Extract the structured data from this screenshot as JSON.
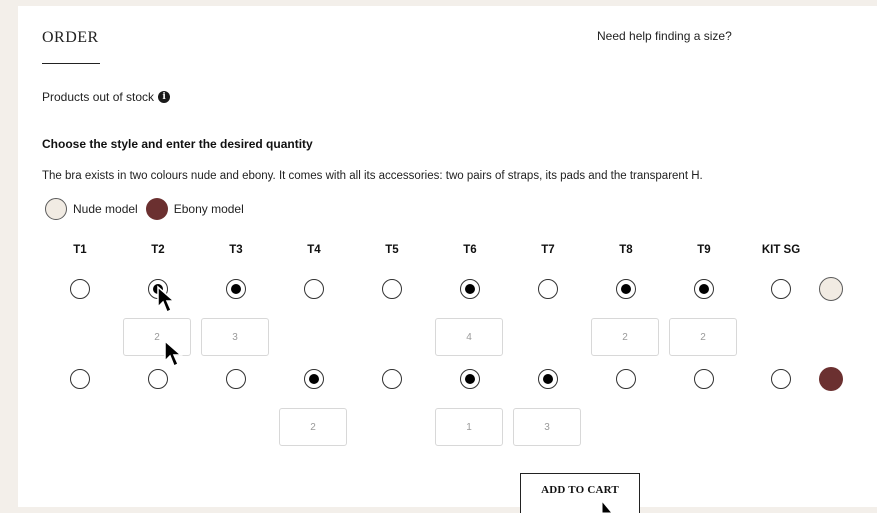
{
  "order": {
    "title": "ORDER",
    "help_link": "Need help finding a size?",
    "out_of_stock": "Products out of stock",
    "heading": "Choose the style and enter the desired quantity",
    "description": "The bra exists in two colours nude and ebony. It comes with all its accessories: two pairs of straps, its pads and the transparent H.",
    "legend": [
      {
        "label": "Nude model",
        "color": "#f1ebe3"
      },
      {
        "label": "Ebony model",
        "color": "#6b3030"
      }
    ],
    "sizes": [
      "T1",
      "T2",
      "T3",
      "T4",
      "T5",
      "T6",
      "T7",
      "T8",
      "T9",
      "KIT SG"
    ],
    "rows": [
      {
        "model": "nude",
        "selected": [
          false,
          true,
          true,
          false,
          false,
          true,
          false,
          true,
          true,
          false
        ],
        "quantities": [
          "",
          "2",
          "3",
          "",
          "",
          "4",
          "",
          "2",
          "2",
          ""
        ]
      },
      {
        "model": "ebony",
        "selected": [
          false,
          false,
          false,
          true,
          false,
          true,
          true,
          false,
          false,
          false
        ],
        "quantities": [
          "",
          "",
          "",
          "2",
          "",
          "1",
          "3",
          "",
          "",
          ""
        ]
      }
    ],
    "add_to_cart": "ADD TO CART"
  },
  "icons": {
    "info": "info-icon",
    "cursor": "mouse-pointer-icon"
  },
  "colors": {
    "page_bg": "#f3efea",
    "nude": "#f1ebe3",
    "ebony": "#6b3030"
  }
}
